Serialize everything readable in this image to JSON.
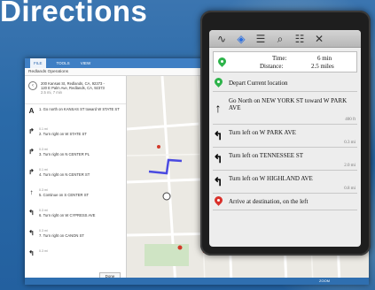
{
  "slide": {
    "title": "Directions"
  },
  "app": {
    "ribbon_tabs": [
      "FILE",
      "TOOLS",
      "VIEW"
    ],
    "window_title": "Redlands Operations",
    "address_lines": [
      "200 Kansas St, Redlands, CA, 92373 -",
      "120 E Palm Ave, Redlands, CA, 92373"
    ],
    "address_meta": "2.5 mi, 7 min",
    "steps": [
      {
        "icon": "A",
        "dist": "",
        "text": "1. Go north on KANSAS ST toward W STATE ST"
      },
      {
        "icon": "↱",
        "dist": "0.1 mi",
        "text": "2. Turn right on W STATE ST"
      },
      {
        "icon": "↱",
        "dist": "0.3 mi",
        "text": "3. Turn right on N CENTER PL"
      },
      {
        "icon": "↱",
        "dist": "0.1 mi",
        "text": "4. Turn right on N CENTER ST"
      },
      {
        "icon": "↑",
        "dist": "0.3 mi",
        "text": "5. Continue on S CENTER ST"
      },
      {
        "icon": "↰",
        "dist": "0.3 mi",
        "text": "6. Turn right on W CYPRESS AVE"
      },
      {
        "icon": "↰",
        "dist": "0.3 mi",
        "text": "7. Turn right on CANON ST"
      },
      {
        "icon": "↰",
        "dist": "0.3 mi",
        "text": ""
      }
    ],
    "done_label": "Done",
    "zoom_label": "ZOOM"
  },
  "phone": {
    "toolbar_icons": [
      "route-icon",
      "locate-icon",
      "list-icon",
      "search-icon",
      "sliders-icon",
      "tools-icon"
    ],
    "summary": {
      "time_label": "Time:",
      "time_value": "6 min",
      "distance_label": "Distance:",
      "distance_value": "2.5 miles"
    },
    "directions": [
      {
        "icon": "green-pin-icon",
        "text": "Depart Current location",
        "dist": ""
      },
      {
        "icon": "arrow-up-icon",
        "text": "Go North on NEW YORK ST toward W PARK AVE",
        "dist": "400 ft"
      },
      {
        "icon": "turn-left-icon",
        "text": "Turn left on W PARK AVE",
        "dist": "0.3 mi"
      },
      {
        "icon": "turn-left-icon",
        "text": "Turn left on TENNESSEE ST",
        "dist": "2.0 mi"
      },
      {
        "icon": "turn-left-icon",
        "text": "Turn left on W HIGHLAND AVE",
        "dist": "0.8 mi"
      },
      {
        "icon": "red-pin-icon",
        "text": "Arrive at destination, on the left",
        "dist": ""
      }
    ],
    "colors": {
      "start_pin": "#2db34a",
      "end_pin": "#d9302a",
      "route": "#3a3ad0"
    }
  }
}
